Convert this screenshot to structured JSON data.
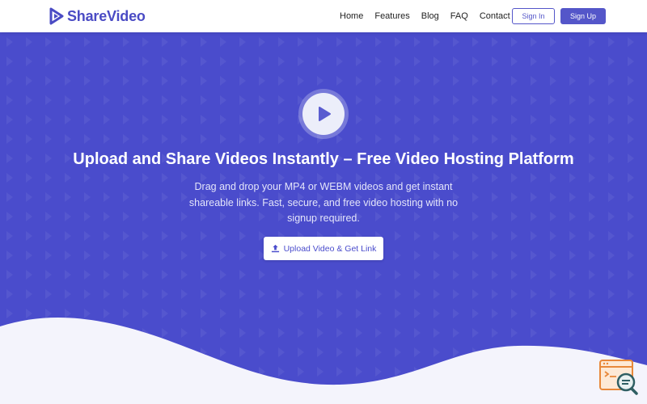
{
  "brand": {
    "name": "ShareVideo",
    "primary_color": "#4a4ccc",
    "accent_color": "#5456c9"
  },
  "nav": {
    "items": [
      {
        "label": "Home"
      },
      {
        "label": "Features"
      },
      {
        "label": "Blog"
      },
      {
        "label": "FAQ"
      },
      {
        "label": "Contact Us"
      }
    ],
    "sign_in": "Sign In",
    "sign_up": "Sign Up"
  },
  "hero": {
    "icon": "play-icon",
    "title": "Upload and Share Videos Instantly – Free Video Hosting Platform",
    "subtitle": "Drag and drop your MP4 or WEBM videos and get instant shareable links. Fast, secure, and free video hosting with no signup required.",
    "cta_label": "Upload Video & Get Link",
    "cta_icon": "upload-icon"
  },
  "widget": {
    "icon": "code-search-icon"
  }
}
